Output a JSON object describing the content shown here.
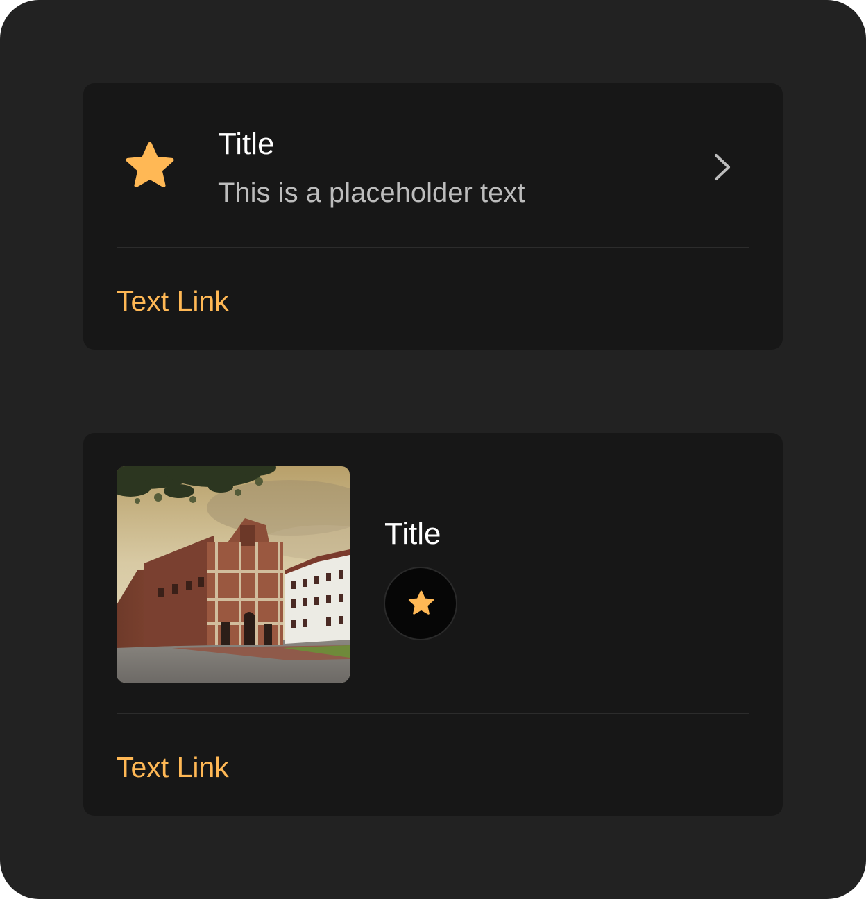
{
  "colors": {
    "background": "#222222",
    "card": "#171717",
    "accent": "#ffb855",
    "title": "#ffffff",
    "subtitle": "#bdbdbd",
    "divider": "#2c2c2c"
  },
  "list_card": {
    "icon": "star-icon",
    "title": "Title",
    "subtitle": "This is a placeholder text",
    "trailing_icon": "chevron-right-icon",
    "link_label": "Text Link"
  },
  "media_card": {
    "image": "church-facade-photo",
    "title": "Title",
    "action_icon": "star-icon",
    "link_label": "Text Link"
  }
}
